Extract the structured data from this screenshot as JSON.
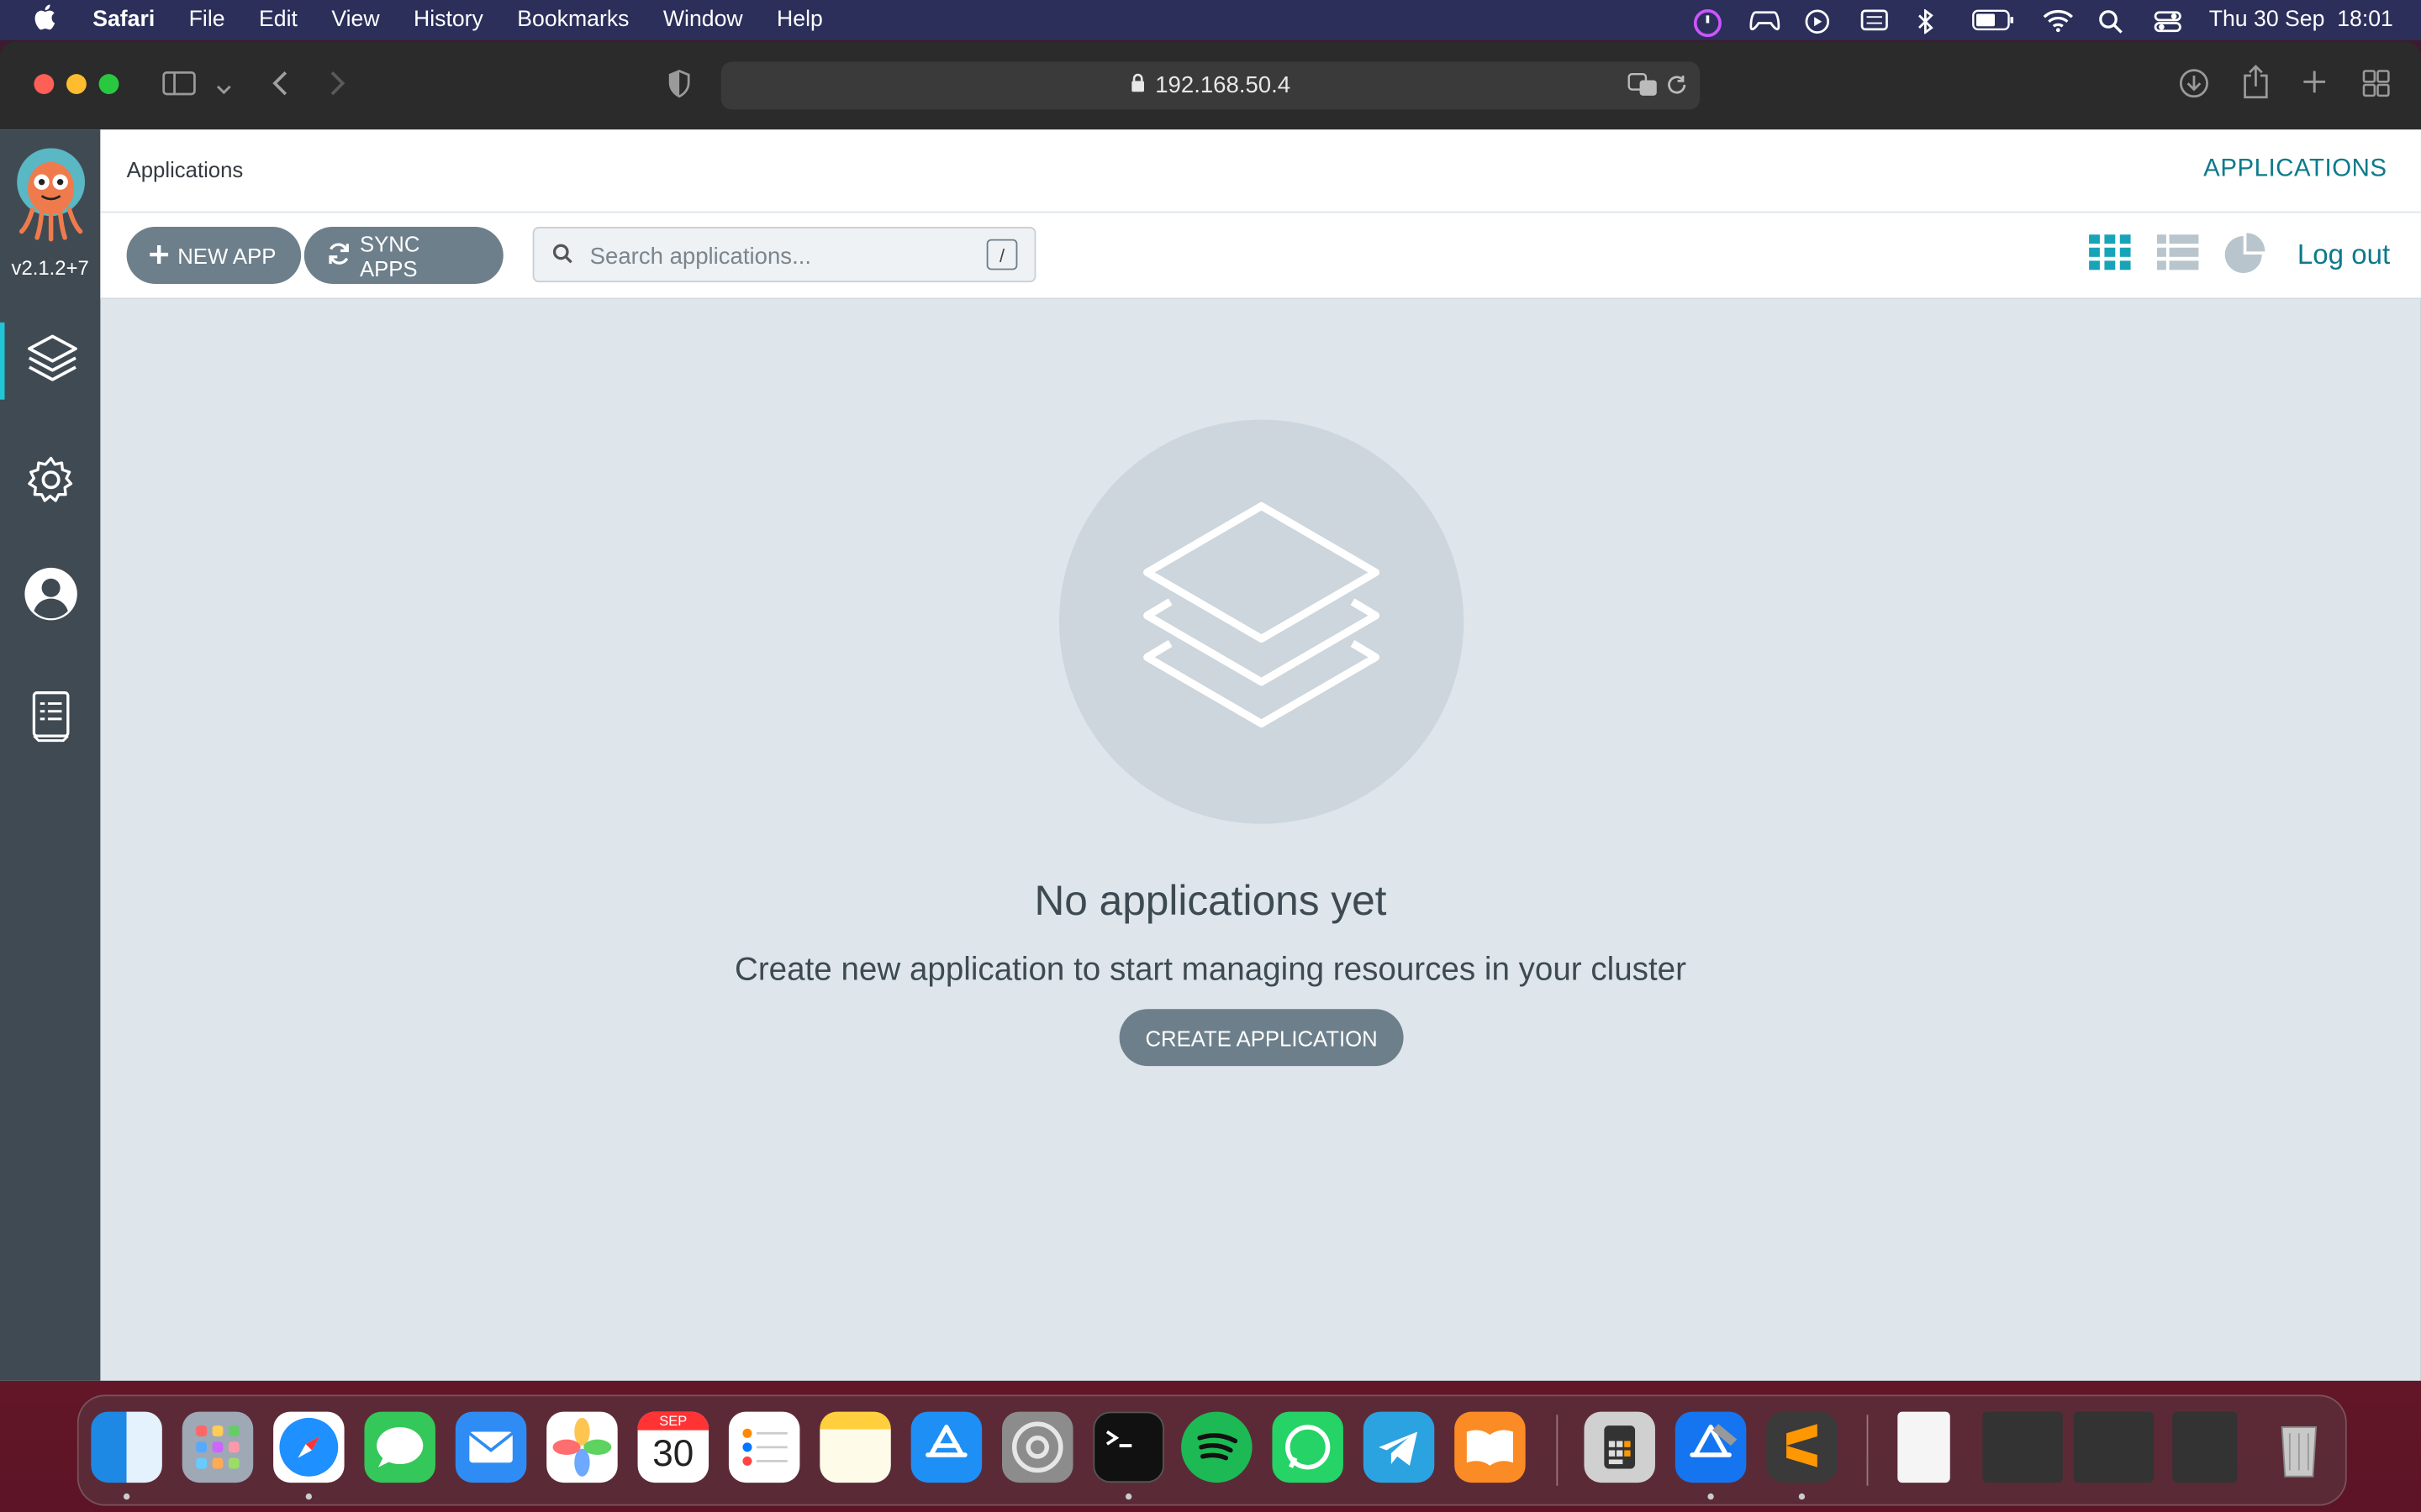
{
  "menubar": {
    "app": "Safari",
    "items": [
      "File",
      "Edit",
      "View",
      "History",
      "Bookmarks",
      "Window",
      "Help"
    ],
    "clock": "Thu 30 Sep  18:01"
  },
  "browser": {
    "url": "192.168.50.4"
  },
  "sidebar": {
    "version": "v2.1.2+7"
  },
  "topbar": {
    "breadcrumb": "Applications",
    "title": "APPLICATIONS"
  },
  "actions": {
    "new_app": "NEW APP",
    "sync_apps": "SYNC APPS",
    "search_placeholder": "Search applications...",
    "search_shortcut": "/",
    "logout": "Log out"
  },
  "empty_state": {
    "title": "No applications yet",
    "subtitle": "Create new application to start managing resources in your cluster",
    "button": "CREATE APPLICATION"
  },
  "dock": {
    "calendar_month": "SEP",
    "calendar_day": "30"
  },
  "colors": {
    "accent": "#0d7a8a",
    "sidebar": "#404a52",
    "button": "#6d7f8b",
    "page_bg": "#dee6eb"
  }
}
